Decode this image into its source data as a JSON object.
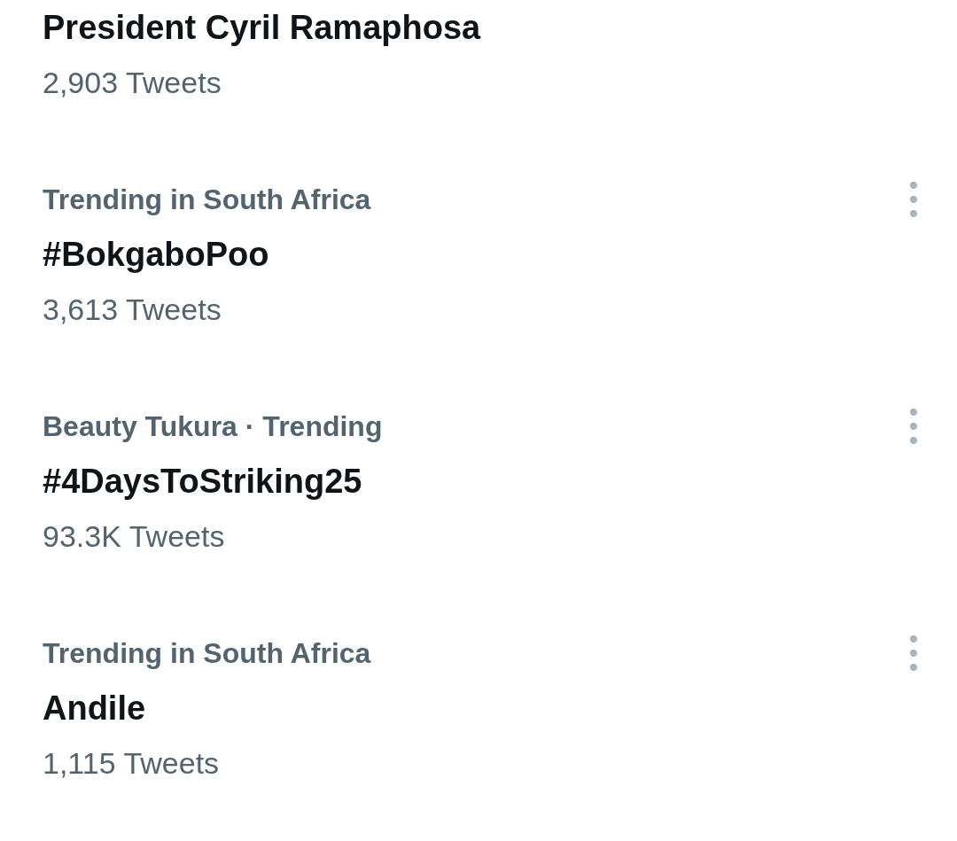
{
  "trends": [
    {
      "title": "President Cyril Ramaphosa",
      "count": "2,903 Tweets",
      "more_button": false
    },
    {
      "context": "Trending in South Africa",
      "title": "#BokgaboPoo",
      "count": "3,613 Tweets",
      "more_button": true
    },
    {
      "context": "Beauty Tukura · Trending",
      "title": "#4DaysToStriking25",
      "count": "93.3K Tweets",
      "more_button": true
    },
    {
      "context": "Trending in South Africa",
      "title": "Andile",
      "count": "1,115 Tweets",
      "more_button": true
    }
  ]
}
